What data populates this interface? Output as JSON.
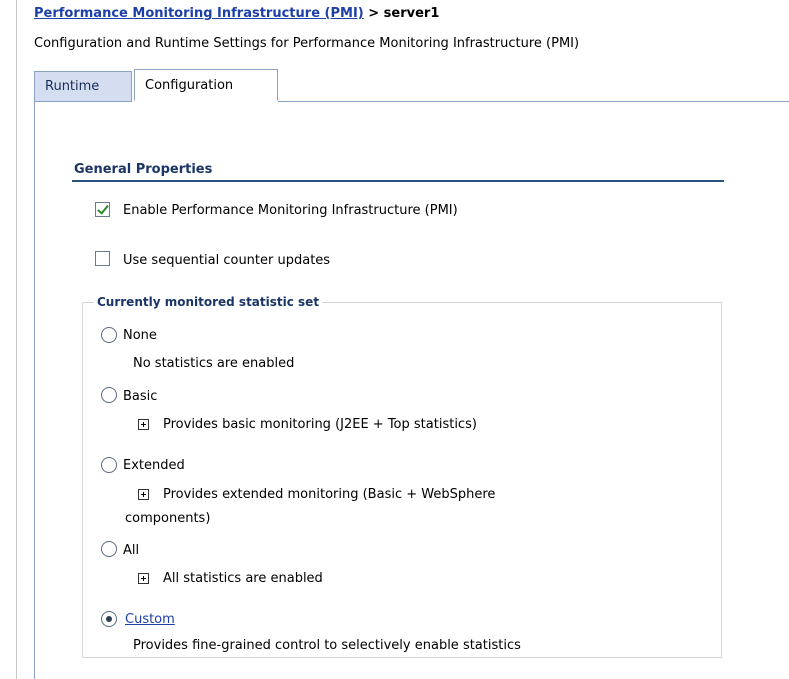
{
  "breadcrumb": {
    "link": "Performance Monitoring Infrastructure (PMI)",
    "separator": " > ",
    "current": "server1"
  },
  "page_description": "Configuration and Runtime Settings for Performance Monitoring Infrastructure (PMI)",
  "tabs": [
    {
      "label": "Runtime",
      "active": false
    },
    {
      "label": "Configuration",
      "active": true
    }
  ],
  "general_properties": {
    "heading": "General Properties",
    "enable_pmi": {
      "label": "Enable Performance Monitoring Infrastructure (PMI)",
      "checked": true
    },
    "sequential_updates": {
      "label": "Use sequential counter updates",
      "checked": false
    }
  },
  "statistic_set": {
    "legend": "Currently monitored statistic set",
    "selected": "Custom",
    "options": [
      {
        "label": "None",
        "description": "No statistics are enabled"
      },
      {
        "label": "Basic",
        "description": "Provides basic monitoring (J2EE + Top statistics)"
      },
      {
        "label": "Extended",
        "description_line1": "Provides extended monitoring (Basic + WebSphere",
        "description_line2": "components)"
      },
      {
        "label": "All",
        "description": "All statistics are enabled"
      },
      {
        "label": "Custom",
        "description": "Provides fine-grained control to selectively enable statistics"
      }
    ]
  },
  "icons": {
    "checkbox_check_color": "#2b8a2b",
    "link_color": "#1d3fa8",
    "heading_color": "#1a3566"
  }
}
